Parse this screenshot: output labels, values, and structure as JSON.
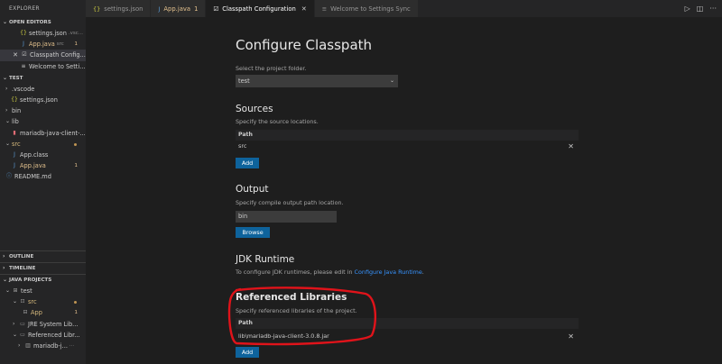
{
  "sidebar": {
    "title": "EXPLORER",
    "open_editors": {
      "label": "OPEN EDITORS",
      "items": [
        {
          "icon": "{}",
          "name": "settings.json",
          "extra": ".vsc..."
        },
        {
          "icon": "J",
          "name": "App.java",
          "extra": "src",
          "badge": "1"
        },
        {
          "icon": "☑",
          "name": "Classpath Config..."
        },
        {
          "icon": "≡",
          "name": "Welcome to Setti..."
        }
      ]
    },
    "test": {
      "label": "TEST",
      "items": [
        {
          "chev": "›",
          "name": ".vscode"
        },
        {
          "icon": "{}",
          "name": "settings.json"
        },
        {
          "chev": "›",
          "name": "bin"
        },
        {
          "chev": "⌄",
          "name": "lib"
        },
        {
          "icon": "▮",
          "name": "mariadb-java-client-..."
        },
        {
          "chev": "⌄",
          "name": "src"
        },
        {
          "icon": "J",
          "name": "App.class"
        },
        {
          "icon": "J",
          "name": "App.java",
          "badge": "1"
        },
        {
          "icon": "ⓘ",
          "name": "README.md"
        }
      ]
    },
    "outline": "OUTLINE",
    "timeline": "TIMELINE",
    "java_projects": {
      "label": "JAVA PROJECTS",
      "items": [
        {
          "chev": "⌄",
          "name": "test"
        },
        {
          "chev": "⌄",
          "name": "src"
        },
        {
          "name": "App",
          "badge": "1"
        },
        {
          "chev": "›",
          "name": "JRE System Lib..."
        },
        {
          "chev": "⌄",
          "name": "Referenced Libr..."
        },
        {
          "chev": "›",
          "name": "mariadb-j...",
          "extra": "···"
        }
      ]
    }
  },
  "tabs": [
    {
      "icon": "{}",
      "label": "settings.json"
    },
    {
      "icon": "J",
      "label": "App.java",
      "badge": "1"
    },
    {
      "icon": "☑",
      "label": "Classpath Configuration",
      "close": "✕"
    },
    {
      "icon": "≡",
      "label": "Welcome to Settings Sync"
    }
  ],
  "main": {
    "title": "Configure Classpath",
    "project_label": "Select the project folder.",
    "project_value": "test",
    "sources": {
      "heading": "Sources",
      "desc": "Specify the source locations.",
      "col": "Path",
      "rows": [
        "src"
      ],
      "add": "Add"
    },
    "output": {
      "heading": "Output",
      "desc": "Specify compile output path location.",
      "value": "bin",
      "browse": "Browse"
    },
    "jdk": {
      "heading": "JDK Runtime",
      "desc_pre": "To configure JDK runtimes, please edit in ",
      "link": "Configure Java Runtime",
      "desc_post": "."
    },
    "libs": {
      "heading": "Referenced Libraries",
      "desc": "Specify referenced libraries of the project.",
      "col": "Path",
      "rows": [
        "lib\\mariadb-java-client-3.0.8.jar"
      ],
      "add": "Add"
    }
  },
  "colors": {
    "accent": "#0e639c",
    "annotation": "#e0131a"
  }
}
